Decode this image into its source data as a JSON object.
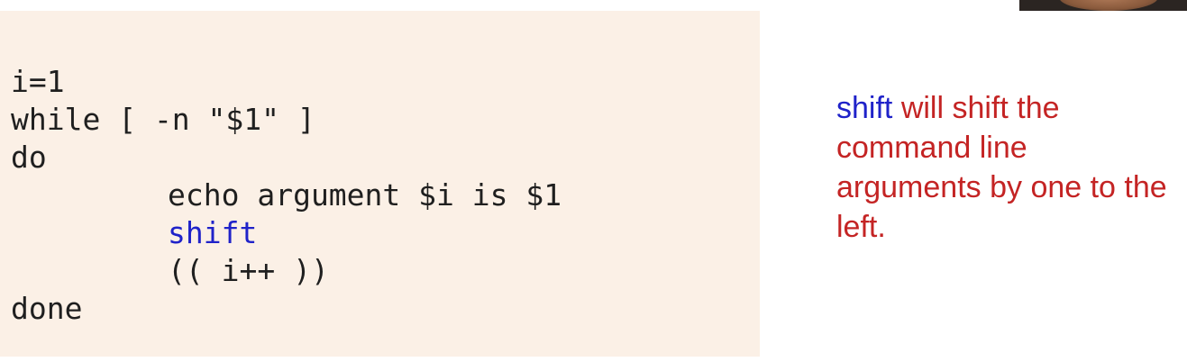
{
  "code": {
    "lines": [
      "i=1",
      "while [ -n \"$1\" ]",
      "do",
      "echo argument $i is $1",
      "shift",
      "(( i++ ))",
      "done"
    ]
  },
  "note": {
    "keyword": "shift",
    "text": "will shift the command line arguments by one to the left."
  },
  "colors": {
    "keyword_blue": "#1f22c9",
    "note_red": "#c42424",
    "code_background": "#fbf0e6"
  },
  "icons": {
    "webcam": "webcam-thumbnail"
  }
}
